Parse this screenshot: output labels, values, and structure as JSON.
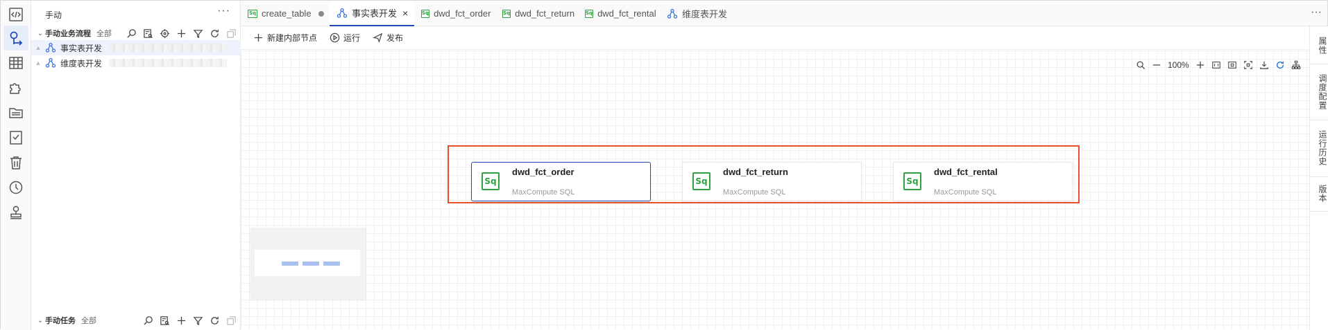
{
  "rail": {
    "items": [
      {
        "name": "code-icon",
        "active": false
      },
      {
        "name": "data-dev-icon",
        "active": true
      },
      {
        "name": "table-icon",
        "active": false
      },
      {
        "name": "component-icon",
        "active": false
      },
      {
        "name": "folder-icon",
        "active": false
      },
      {
        "name": "checklist-icon",
        "active": false
      },
      {
        "name": "trash-icon",
        "active": false
      },
      {
        "name": "clock-icon",
        "active": false
      },
      {
        "name": "user-stamp-icon",
        "active": false
      }
    ]
  },
  "explorer": {
    "title": "手动",
    "more": "···",
    "section1": {
      "title": "手动业务流程",
      "filter": "全部"
    },
    "items": [
      {
        "label": "事实表开发"
      },
      {
        "label": "维度表开发"
      }
    ],
    "section2": {
      "title": "手动任务",
      "filter": "全部"
    }
  },
  "tabs": [
    {
      "label": "create_table",
      "icon": "sql-icon"
    },
    {
      "label": "事实表开发",
      "icon": "flow-icon",
      "active": true,
      "close": "×"
    },
    {
      "label": "dwd_fct_order",
      "icon": "sql-icon"
    },
    {
      "label": "dwd_fct_return",
      "icon": "sql-icon"
    },
    {
      "label": "dwd_fct_rental",
      "icon": "sql-icon"
    },
    {
      "label": "维度表开发",
      "icon": "flow-icon"
    }
  ],
  "tabs_more": "···",
  "toolbar": {
    "new_node": "新建内部节点",
    "run": "运行",
    "publish": "发布"
  },
  "canvas": {
    "zoom": "100%",
    "sql_badge": "Sq",
    "nodes": [
      {
        "name": "dwd_fct_order",
        "type": "MaxCompute SQL",
        "selected": true
      },
      {
        "name": "dwd_fct_return",
        "type": "MaxCompute SQL",
        "selected": false
      },
      {
        "name": "dwd_fct_rental",
        "type": "MaxCompute SQL",
        "selected": false
      }
    ],
    "highlight_color": "#e5502d"
  },
  "right_panel": {
    "tabs": [
      "属性",
      "调度配置",
      "运行历史",
      "版本"
    ]
  },
  "colors": {
    "accent": "#1f47b9",
    "sql_green": "#2ea141"
  }
}
